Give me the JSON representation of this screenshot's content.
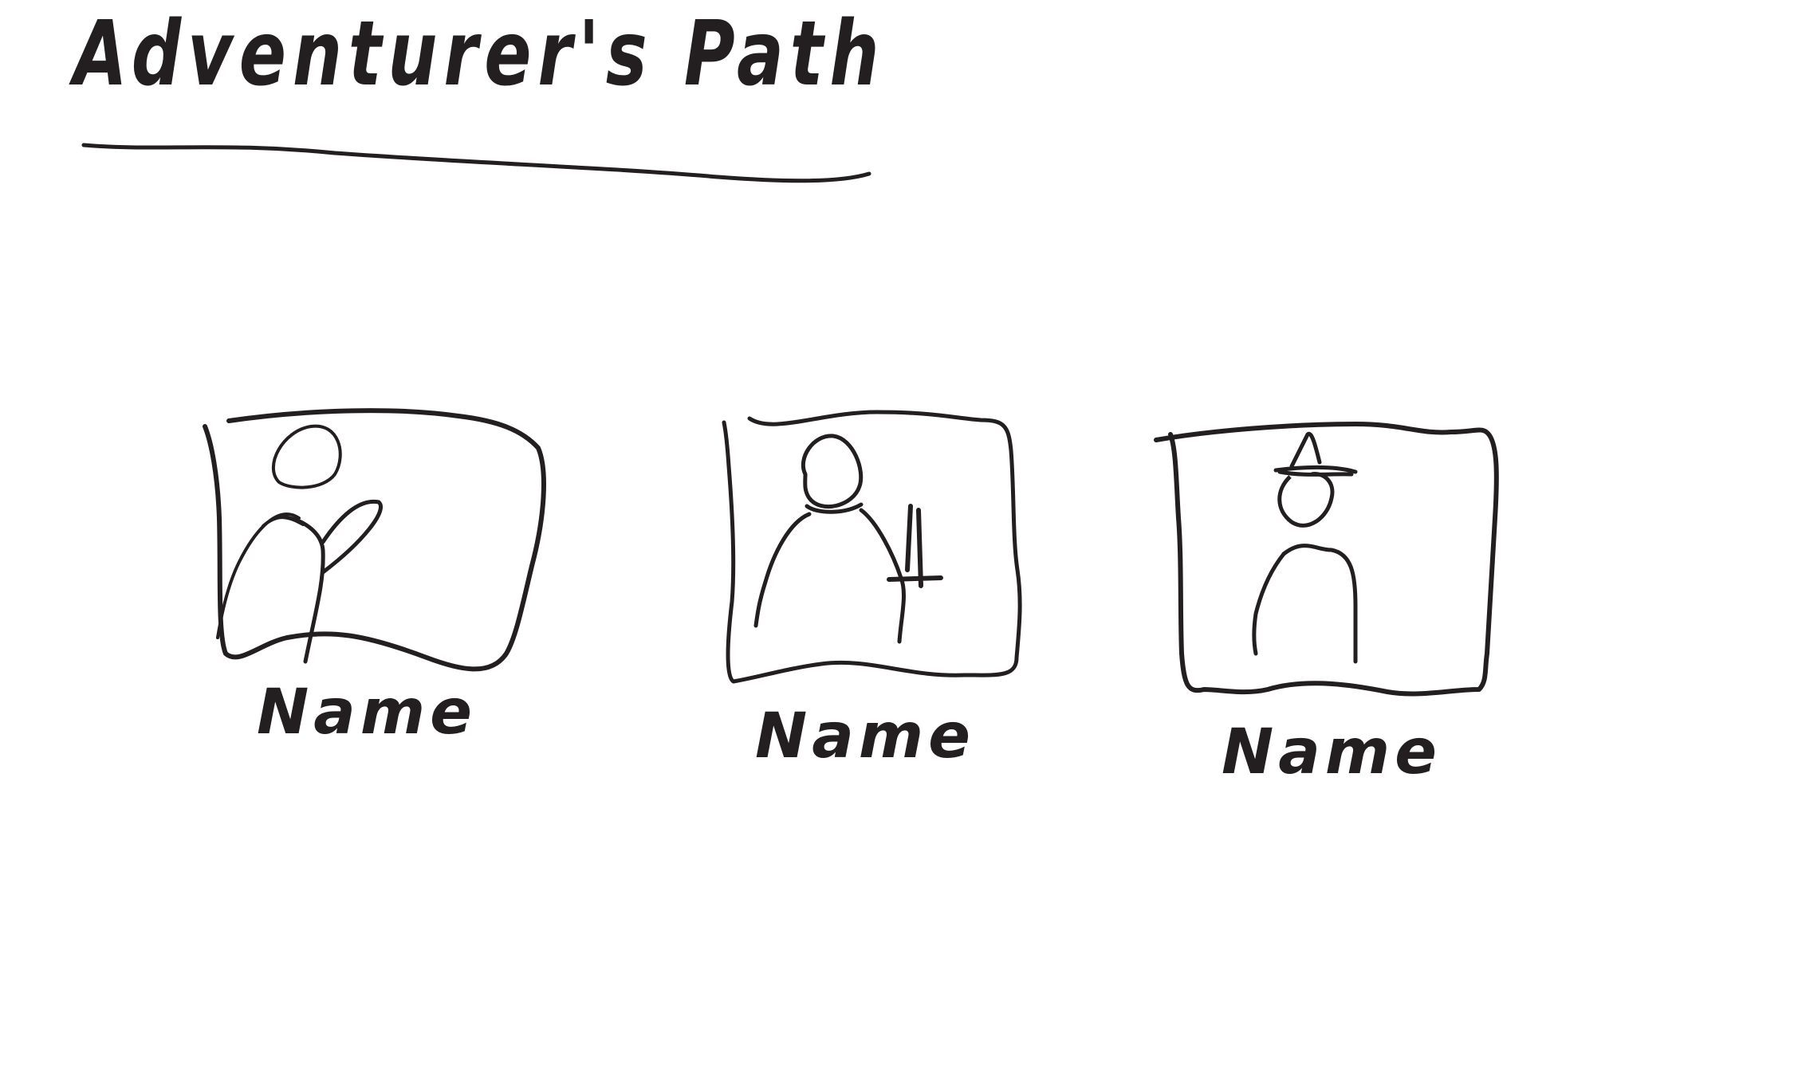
{
  "header": {
    "title": "Adventurer's Path"
  },
  "characters": [
    {
      "name": "Name",
      "avatar_icon": "archer-avatar-icon"
    },
    {
      "name": "Name",
      "avatar_icon": "swordsman-avatar-icon"
    },
    {
      "name": "Name",
      "avatar_icon": "wizard-avatar-icon"
    }
  ],
  "colors": {
    "ink": "#231f20",
    "background": "#ffffff"
  }
}
